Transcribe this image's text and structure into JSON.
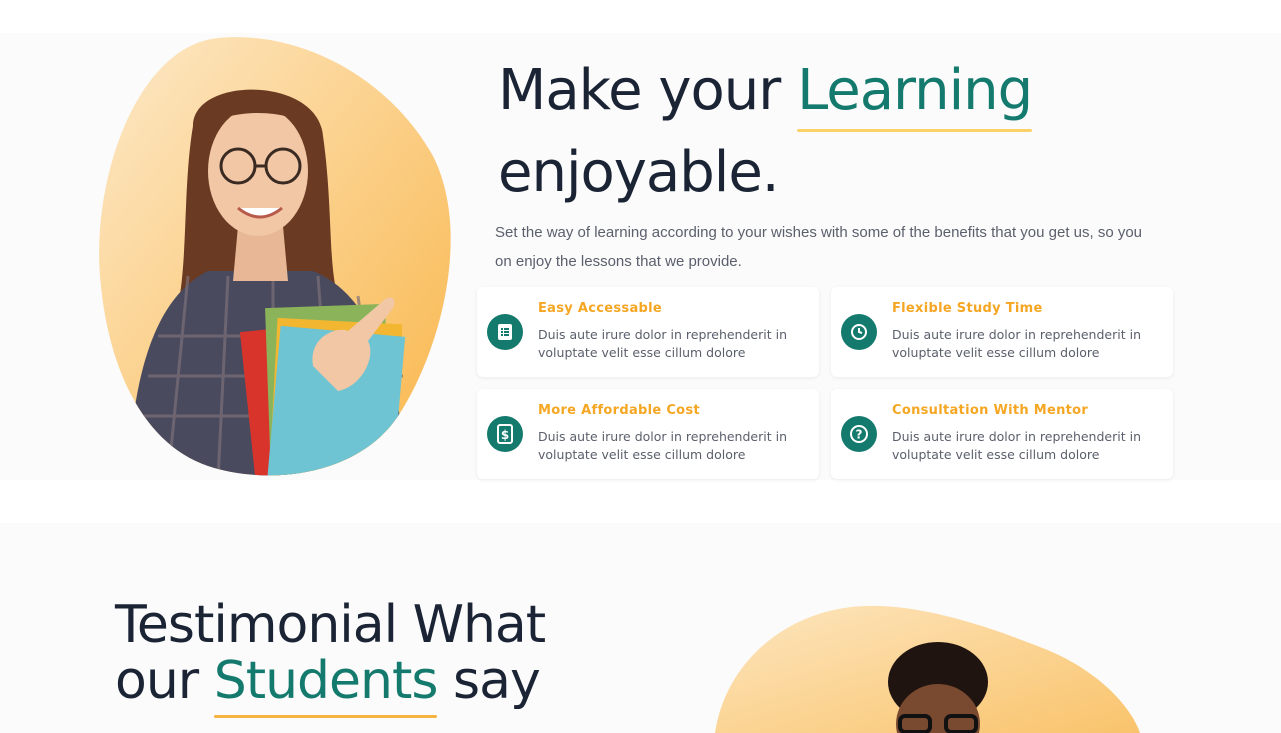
{
  "hero": {
    "headline_part1": "Make your",
    "headline_accent": "Learning",
    "headline_part2": "enjoyable.",
    "description": "Set the way of learning according to your wishes with some of the benefits that you get us, so you on enjoy the lessons that we provide.",
    "image_alt": "Smiling student holding books and pointing"
  },
  "features": [
    {
      "title": "Easy Accessable",
      "text": "Duis aute irure dolor in reprehenderit in voluptate velit esse cillum dolore",
      "icon": "list-icon"
    },
    {
      "title": "Flexible Study Time",
      "text": "Duis aute irure dolor in reprehenderit in voluptate velit esse cillum dolore",
      "icon": "clock-icon"
    },
    {
      "title": "More Affordable Cost",
      "text": "Duis aute irure dolor in reprehenderit in voluptate velit esse cillum dolore",
      "icon": "dollar-icon"
    },
    {
      "title": "Consultation With Mentor",
      "text": "Duis aute irure dolor in reprehenderit in voluptate velit esse cillum dolore",
      "icon": "question-icon"
    }
  ],
  "testimonial": {
    "title_line1": "Testimonial What",
    "title_our": "our",
    "title_accent": "Students",
    "title_say": "say"
  },
  "colors": {
    "accent_green": "#157a6e",
    "accent_orange": "#f5a623",
    "heading": "#1b2434",
    "blob_peach": "#fcd28e"
  }
}
